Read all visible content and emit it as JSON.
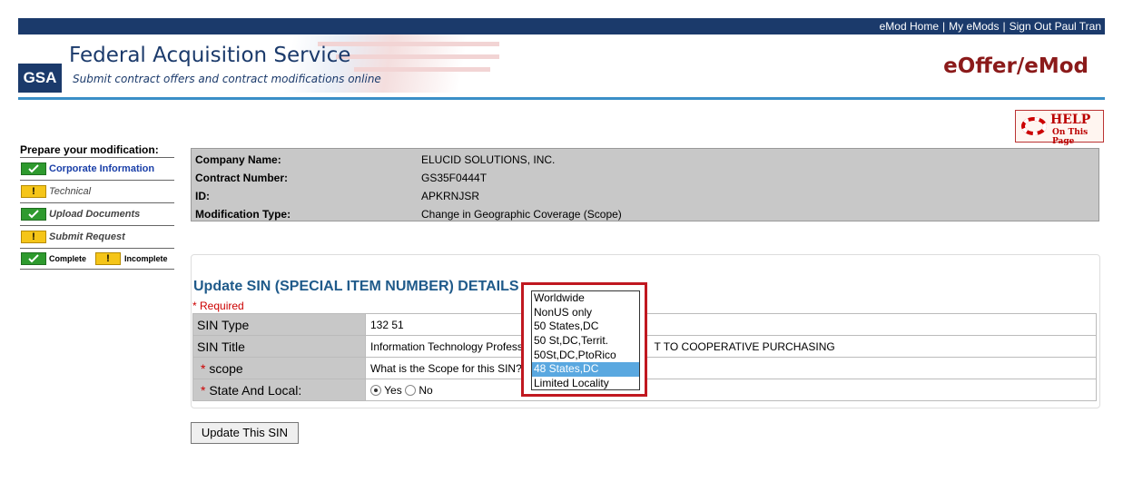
{
  "header": {
    "top_links": [
      "eMod Home",
      "My eMods",
      "Sign Out Paul Tran"
    ],
    "logo_text": "GSA",
    "org_title": "Federal Acquisition Service",
    "org_subtitle": "Submit contract offers and contract modifications online",
    "app_title": "eOffer/eMod"
  },
  "help": {
    "main": "HELP",
    "sub": "On This Page"
  },
  "steps": {
    "title": "Prepare your modification:",
    "items": [
      {
        "label": "Corporate Information",
        "status": "complete"
      },
      {
        "label": "Technical",
        "status": "incomplete"
      },
      {
        "label": "Upload Documents",
        "status": "complete"
      },
      {
        "label": "Submit Request",
        "status": "incomplete"
      }
    ],
    "legend": {
      "complete": "Complete",
      "incomplete": "Incomplete"
    }
  },
  "info": [
    {
      "key": "Company Name:",
      "value": "ELUCID SOLUTIONS, INC."
    },
    {
      "key": "Contract Number:",
      "value": "GS35F0444T"
    },
    {
      "key": "ID:",
      "value": "APKRNJSR"
    },
    {
      "key": "Modification Type:",
      "value": "Change in Geographic Coverage (Scope)"
    }
  ],
  "sin": {
    "title": "Update SIN (SPECIAL ITEM NUMBER) DETAILS",
    "required_note": "* Required",
    "rows": {
      "sin_type": {
        "label": "SIN Type",
        "value": "132 51"
      },
      "sin_title": {
        "label": "SIN Title",
        "value_left": "Information Technology Professi",
        "value_right": "T TO COOPERATIVE PURCHASING"
      },
      "scope": {
        "label": "scope",
        "value": "What is the Scope for this SIN?"
      },
      "state_local": {
        "label": "State And Local:",
        "yes": "Yes",
        "no": "No",
        "selected": "Yes"
      }
    },
    "button": "Update This SIN"
  },
  "dropdown": {
    "options": [
      "Worldwide",
      "NonUS only",
      "50 States,DC",
      "50 St,DC,Territ.",
      "50St,DC,PtoRico",
      "48 States,DC",
      "Limited Locality"
    ],
    "highlighted": "48 States,DC"
  },
  "colors": {
    "navy": "#1b3a6b",
    "accent_red": "#c01820",
    "highlight": "#5aa8e0",
    "complete": "#2e9a2e",
    "incomplete": "#f5c518"
  }
}
